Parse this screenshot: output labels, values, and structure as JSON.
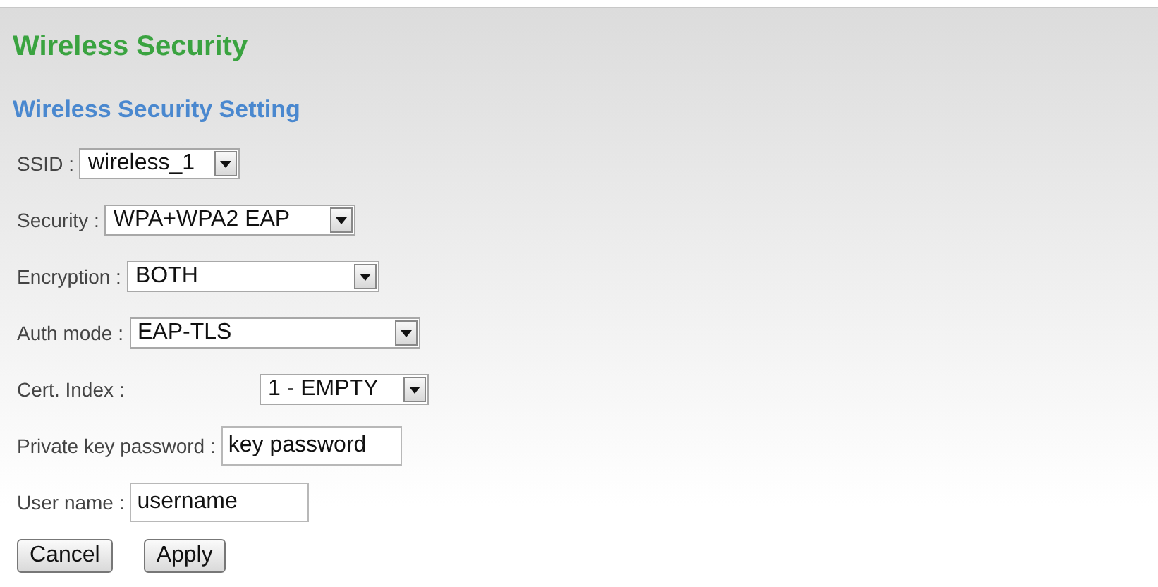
{
  "page_title": "Wireless Security",
  "section_title": "Wireless Security Setting",
  "fields": [
    {
      "label": "SSID :",
      "kind": "select",
      "value": "wireless_1"
    },
    {
      "label": "Security :",
      "kind": "select",
      "value": "WPA+WPA2 EAP"
    },
    {
      "label": "Encryption :",
      "kind": "select",
      "value": "BOTH"
    },
    {
      "label": "Auth mode :",
      "kind": "select",
      "value": "EAP-TLS"
    },
    {
      "label": "Cert. Index :",
      "kind": "select",
      "value": "1 - EMPTY"
    },
    {
      "label": "Private key password :",
      "kind": "text",
      "value": "key password"
    },
    {
      "label": "User name :",
      "kind": "text",
      "value": "username"
    }
  ],
  "buttons": [
    "Cancel",
    "Apply"
  ]
}
